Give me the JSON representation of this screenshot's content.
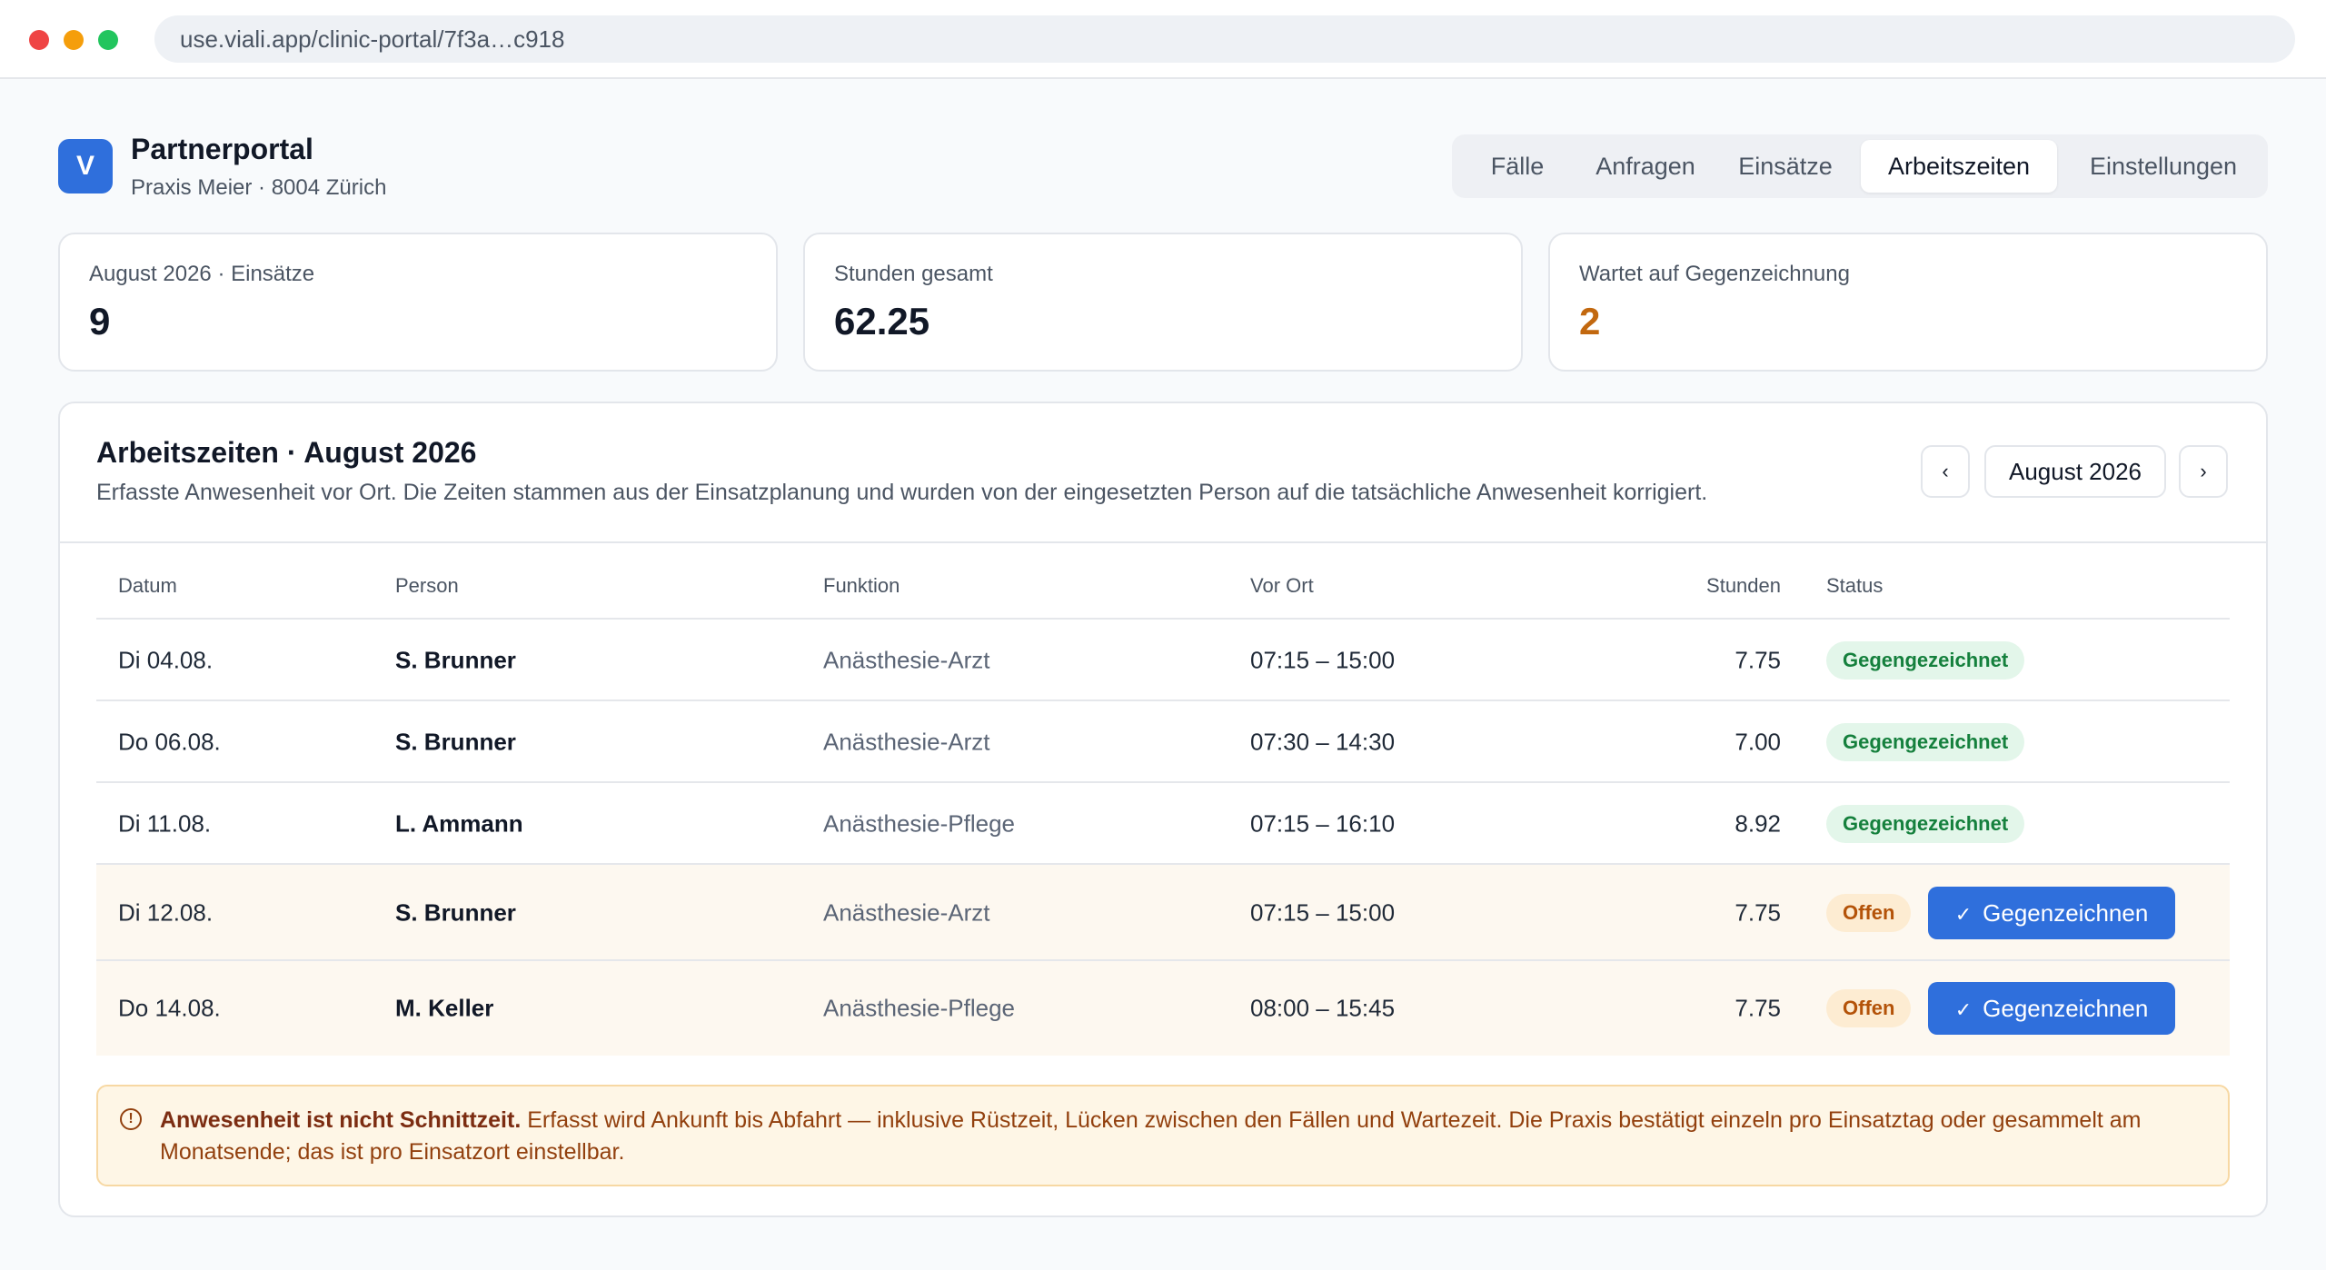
{
  "browser": {
    "url": "use.viali.app/clinic-portal/7f3a…c918"
  },
  "brand": {
    "logo_letter": "V",
    "title": "Partnerportal",
    "subtitle": "Praxis Meier · 8004 Zürich"
  },
  "tabs": [
    {
      "label": "Fälle",
      "active": false
    },
    {
      "label": "Anfragen",
      "active": false
    },
    {
      "label": "Einsätze",
      "active": false
    },
    {
      "label": "Arbeitszeiten",
      "active": true
    },
    {
      "label": "Einstellungen",
      "active": false
    }
  ],
  "kpis": [
    {
      "label": "August 2026 · Einsätze",
      "value": "9"
    },
    {
      "label": "Stunden gesamt",
      "value": "62.25"
    },
    {
      "label": "Wartet auf Gegenzeichnung",
      "value": "2",
      "color": "#c2680f"
    }
  ],
  "panel": {
    "title": "Arbeitszeiten · August 2026",
    "description": "Erfasste Anwesenheit vor Ort. Die Zeiten stammen aus der Einsatzplanung und wurden von der eingesetzten Person auf die tatsächliche Anwesenheit korrigiert.",
    "prev_label": "‹",
    "month_label": "August 2026",
    "next_label": "›"
  },
  "table": {
    "headers": {
      "date": "Datum",
      "person": "Person",
      "function": "Funktion",
      "onsite": "Vor Ort",
      "hours": "Stunden",
      "status": "Status"
    },
    "rows": [
      {
        "date": "Di 04.08.",
        "person": "S. Brunner",
        "function": "Anästhesie-Arzt",
        "onsite": "07:15 – 15:00",
        "hours": "7.75",
        "status": "Gegengezeichnet"
      },
      {
        "date": "Do 06.08.",
        "person": "S. Brunner",
        "function": "Anästhesie-Arzt",
        "onsite": "07:30 – 14:30",
        "hours": "7.00",
        "status": "Gegengezeichnet"
      },
      {
        "date": "Di 11.08.",
        "person": "L. Ammann",
        "function": "Anästhesie-Pflege",
        "onsite": "07:15 – 16:10",
        "hours": "8.92",
        "status": "Gegengezeichnet"
      },
      {
        "date": "Di 12.08.",
        "person": "S. Brunner",
        "function": "Anästhesie-Arzt",
        "onsite": "07:15 – 15:00",
        "hours": "7.75",
        "status": "Offen",
        "action": "Gegenzeichnen"
      },
      {
        "date": "Do 14.08.",
        "person": "M. Keller",
        "function": "Anästhesie-Pflege",
        "onsite": "08:00 – 15:45",
        "hours": "7.75",
        "status": "Offen",
        "action": "Gegenzeichnen"
      }
    ]
  },
  "note": {
    "icon": "info-icon",
    "bold": "Anwesenheit ist nicht Schnittzeit.",
    "text": " Erfasst wird Ankunft bis Abfahrt — inklusive Rüstzeit, Lücken zwischen den Fällen und Wartezeit. Die Praxis bestätigt einzeln pro Einsatztag oder gesammelt am Monatsende; das ist pro Einsatzort einstellbar."
  },
  "colors": {
    "accent": "#2f6fdc",
    "ok": "#15803d",
    "open": "#b45309",
    "warn": "#c2680f"
  }
}
